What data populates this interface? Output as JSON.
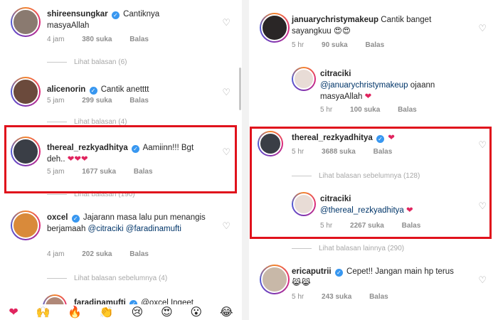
{
  "left": {
    "comments": [
      {
        "username": "shireensungkar",
        "text": "Cantiknya masyaAllah",
        "time": "4 jam",
        "likes": "380 suka",
        "reply": "Balas"
      },
      {
        "username": "alicenorin",
        "text": "Cantik anetttt",
        "time": "5 jam",
        "likes": "299 suka",
        "reply": "Balas"
      },
      {
        "username": "thereal_rezkyadhitya",
        "text": "Aamiinn!!! Bgt deh..",
        "emoji": "❤❤❤",
        "time": "5 jam",
        "likes": "1677 suka",
        "reply": "Balas"
      },
      {
        "username": "oxcel",
        "text": "Jajarann masa lalu pun menangis berjamaah",
        "mention1": "@citraciki",
        "mention2": "@faradinamufti",
        "time": "4 jam",
        "likes": "202 suka",
        "reply": "Balas"
      },
      {
        "username": "faradinamufti",
        "text": "@oxcel Ingeet"
      }
    ],
    "view_replies": [
      "Lihat balasan (6)",
      "Lihat balasan (4)",
      "Lihat balasan (190)",
      "Lihat balasan sebelumnya (4)"
    ],
    "reactions": [
      "❤",
      "🙌",
      "🔥",
      "👏",
      "😢",
      "😍",
      "😮",
      "😂"
    ]
  },
  "right": {
    "comments": [
      {
        "username": "januarychristymakeup",
        "text": "Cantik banget sayangkuu",
        "emoji": "😍😍",
        "time": "5 hr",
        "likes": "90 suka",
        "reply": "Balas"
      },
      {
        "username": "citraciki",
        "mention": "@januarychristymakeup",
        "text": "ojaann masyaAllah",
        "emoji": "❤",
        "time": "5 hr",
        "likes": "100 suka",
        "reply": "Balas"
      },
      {
        "username": "thereal_rezkyadhitya",
        "emoji": "❤",
        "time": "5 hr",
        "likes": "3688 suka",
        "reply": "Balas"
      },
      {
        "username": "citraciki",
        "mention": "@thereal_rezkyadhitya",
        "emoji": "❤",
        "time": "5 hr",
        "likes": "2267 suka",
        "reply": "Balas"
      },
      {
        "username": "ericaputrii",
        "text": "Cepet!! Jangan main hp terus",
        "emoji": "😹😹",
        "time": "5 hr",
        "likes": "243 suka",
        "reply": "Balas"
      }
    ],
    "view_replies": [
      "Lihat balasan sebelumnya (128)",
      "Lihat balasan lainnya (290)"
    ]
  },
  "colors": {
    "highlight": "#e0121c",
    "verified": "#3897f0",
    "heart": "#e0245e"
  },
  "icons": {
    "like": "heart-outline-icon",
    "verified": "verified-badge-icon"
  }
}
